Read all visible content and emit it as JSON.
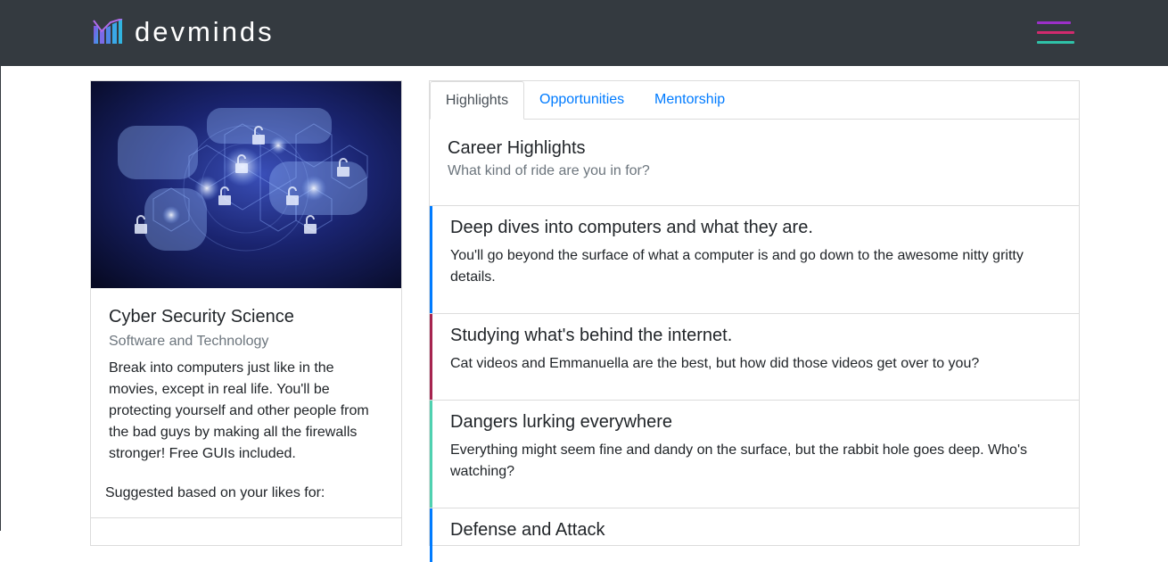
{
  "brand": {
    "name": "devminds"
  },
  "colors": {
    "navbar": "#343a40",
    "link": "#007bff",
    "accent_blue": "#007bff",
    "accent_crimson": "#a6244f",
    "accent_teal": "#4fd1b0"
  },
  "icons": {
    "menu": "hamburger-icon",
    "logo": "devminds-logo-icon"
  },
  "course": {
    "title": "Cyber Security Science",
    "category": "Software and Technology",
    "description": "Break into computers just like in the movies, except in real life. You'll be protecting yourself and other people from the bad guys by making all the firewalls stronger! Free GUIs included.",
    "suggested_label": "Suggested based on your likes for:"
  },
  "tabs": [
    "Highlights",
    "Opportunities",
    "Mentorship"
  ],
  "highlights": {
    "title": "Career Highlights",
    "subtitle": "What kind of ride are you in for?",
    "items": [
      {
        "title": "Deep dives into computers and what they are.",
        "text": "You'll go beyond the surface of what a computer is and go down to the awesome nitty gritty details.",
        "color": "#007bff"
      },
      {
        "title": "Studying what's behind the internet.",
        "text": "Cat videos and Emmanuella are the best, but how did those videos get over to you?",
        "color": "#a6244f"
      },
      {
        "title": "Dangers lurking everywhere",
        "text": "Everything might seem fine and dandy on the surface, but the rabbit hole goes deep. Who's watching?",
        "color": "#4fd1b0"
      },
      {
        "title": "Defense and Attack",
        "color": "#007bff"
      }
    ]
  }
}
